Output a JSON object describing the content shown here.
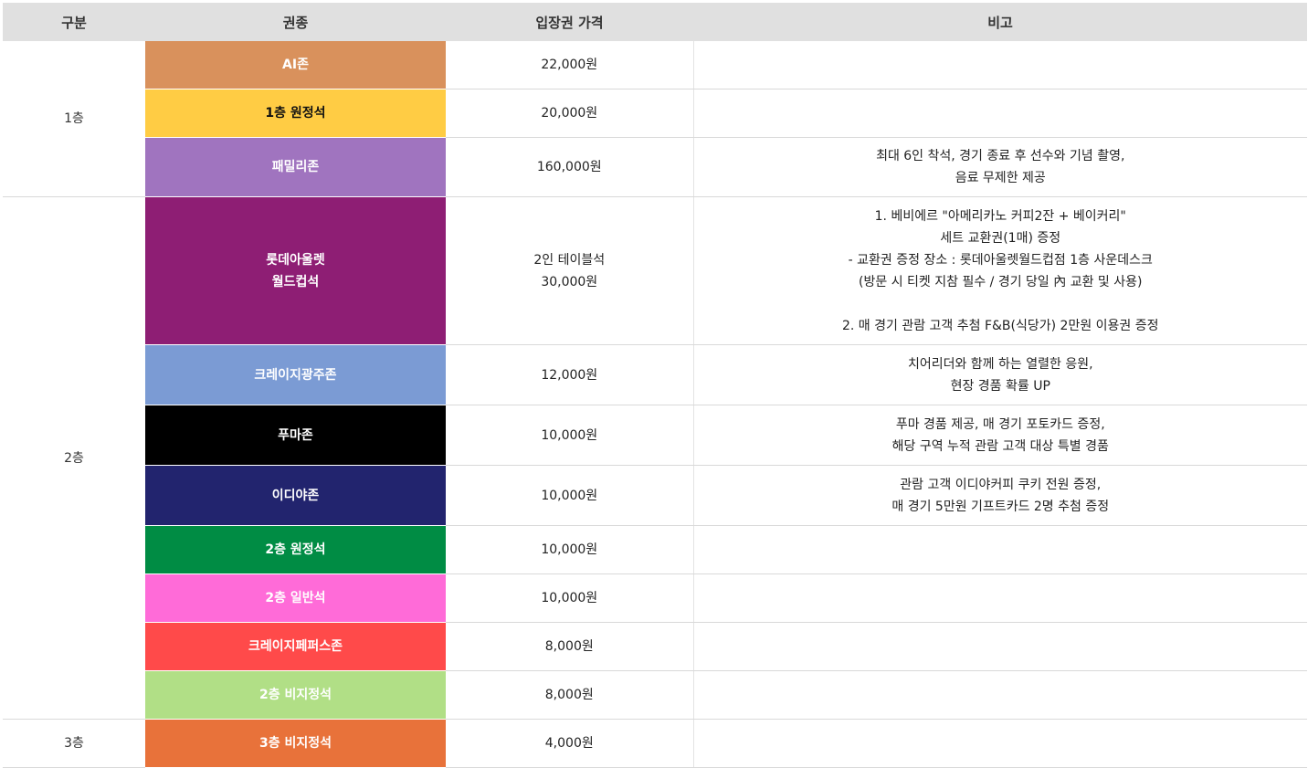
{
  "headers": {
    "floor": "구분",
    "ticket_type": "권종",
    "price": "입장권 가격",
    "note": "비고"
  },
  "floors": {
    "f1": "1층",
    "f2": "2층",
    "f3": "3층"
  },
  "rows": [
    {
      "ticket": "AI존",
      "color": "#d9915c",
      "price": "22,000원",
      "note": ""
    },
    {
      "ticket": "1층 원정석",
      "color": "#ffcc44",
      "price": "20,000원",
      "note": ""
    },
    {
      "ticket": "패밀리존",
      "color": "#a074bf",
      "price": "160,000원",
      "note": "최대 6인 착석, 경기 종료 후 선수와 기념 촬영,\n음료 무제한 제공"
    },
    {
      "ticket": "롯데아울렛\n월드컵석",
      "color": "#8e1e74",
      "price": "2인 테이블석\n30,000원",
      "note": "1. 베비에르 \"아메리카노 커피2잔 + 베이커리\"\n세트 교환권(1매) 증정\n- 교환권 증정 장소 : 롯데아울렛월드컵점 1층 사운데스크\n(방문 시 티켓 지참 필수 / 경기 당일 內 교환 및 사용)\n\n2. 매 경기 관람 고객 추첨 F&B(식당가) 2만원 이용권 증정"
    },
    {
      "ticket": "크레이지광주존",
      "color": "#7b9bd4",
      "price": "12,000원",
      "note": "치어리더와 함께 하는 열렬한 응원,\n현장 경품 확률 UP"
    },
    {
      "ticket": "푸마존",
      "color": "#000000",
      "price": "10,000원",
      "note": "푸마 경품 제공, 매 경기 포토카드 증정,\n해당 구역 누적 관람 고객 대상 특별 경품"
    },
    {
      "ticket": "이디야존",
      "color": "#22246e",
      "price": "10,000원",
      "note": "관람 고객 이디야커피 쿠키 전원 증정,\n매 경기 5만원 기프트카드 2명 추첨 증정"
    },
    {
      "ticket": "2층 원정석",
      "color": "#008c44",
      "price": "10,000원",
      "note": ""
    },
    {
      "ticket": "2층 일반석",
      "color": "#ff6bd8",
      "price": "10,000원",
      "note": ""
    },
    {
      "ticket": "크레이지페퍼스존",
      "color": "#ff4a4a",
      "price": "8,000원",
      "note": ""
    },
    {
      "ticket": "2층 비지정석",
      "color": "#b1df86",
      "price": "8,000원",
      "note": ""
    },
    {
      "ticket": "3층 비지정석",
      "color": "#e8723a",
      "price": "4,000원",
      "note": ""
    }
  ]
}
